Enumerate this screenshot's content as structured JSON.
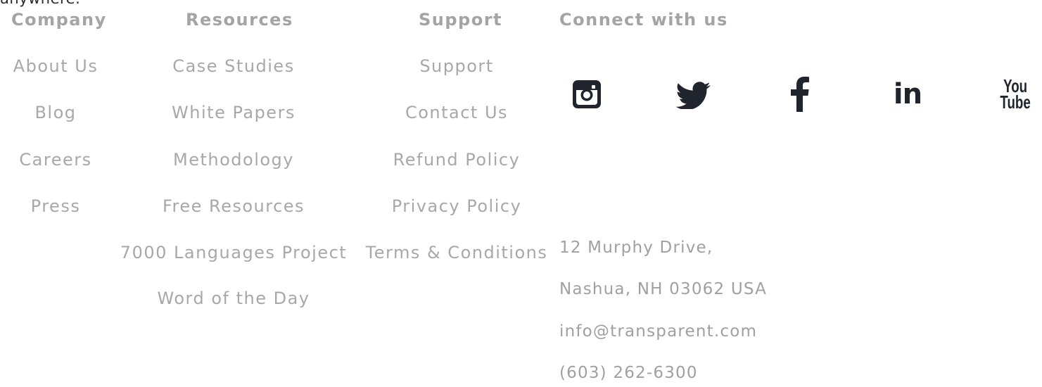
{
  "top_fragment": "anywhere.",
  "columns": {
    "company": {
      "heading": "Company",
      "links": [
        "About Us",
        "Blog",
        "Careers",
        "Press"
      ]
    },
    "resources": {
      "heading": "Resources",
      "links": [
        "Case Studies",
        "White Papers",
        "Methodology",
        "Free Resources",
        "7000 Languages Project",
        "Word of the Day"
      ]
    },
    "support": {
      "heading": "Support",
      "links": [
        "Support",
        "Contact Us",
        "Refund Policy",
        "Privacy Policy",
        "Terms & Conditions"
      ]
    }
  },
  "connect": {
    "heading": "Connect with us",
    "social": [
      "instagram-icon",
      "twitter-icon",
      "facebook-icon",
      "linkedin-icon",
      "youtube-icon"
    ],
    "youtube_text_top": "You",
    "youtube_text_bottom": "Tube",
    "linkedin_text": "in"
  },
  "contact": {
    "address_line1": "12 Murphy Drive,",
    "address_line2": "Nashua, NH 03062 USA",
    "email": "info@transparent.com",
    "phone": "(603) 262-6300"
  },
  "colors": {
    "heading": "#a4a4a4",
    "link": "#a8a8a8",
    "icon": "#20252d"
  }
}
